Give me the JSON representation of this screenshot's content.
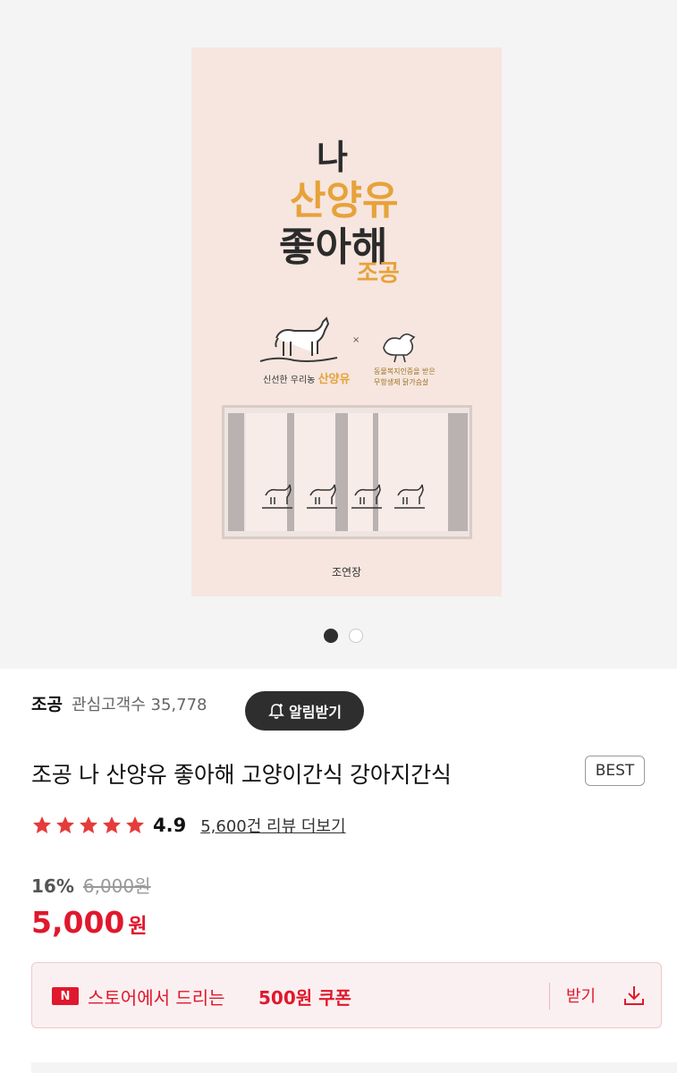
{
  "product_image": {
    "package_title_line1": "나",
    "package_title_line2": "산양유",
    "package_title_line3": "좋아해",
    "package_brand_mark": "조공",
    "times_symbol": "×",
    "caption_left_prefix": "신선한 우리농",
    "caption_left_emph": "산양유",
    "caption_right_line1": "동물복지인증을 받은",
    "caption_right_line2": "무항생제 닭가슴살",
    "maker": "조연장"
  },
  "carousel": {
    "current_page": 1,
    "total_pages": 2
  },
  "store": {
    "name": "조공",
    "interest_label": "관심고객수",
    "interest_count": "35,778",
    "alarm_button": "알림받기"
  },
  "product": {
    "title": "조공 나 산양유 좋아해 고양이간식 강아지간식",
    "badge": "BEST",
    "rating": "4.9",
    "rating_stars": 5,
    "reviews_link": "5,600건 리뷰 더보기",
    "discount": "16%",
    "original_price": "6,000원",
    "price": "5,000",
    "price_unit": "원"
  },
  "coupon": {
    "badge": "N",
    "text_prefix": "스토어에서 드리는",
    "text_strong": "500원 쿠폰",
    "receive_label": "받기",
    "icon": "download-icon"
  },
  "colors": {
    "accent": "#e0182d",
    "dark": "#2e2e2e",
    "star": "#e63b3b",
    "package": "#f6e6df",
    "package_accent": "#e7a23a"
  }
}
